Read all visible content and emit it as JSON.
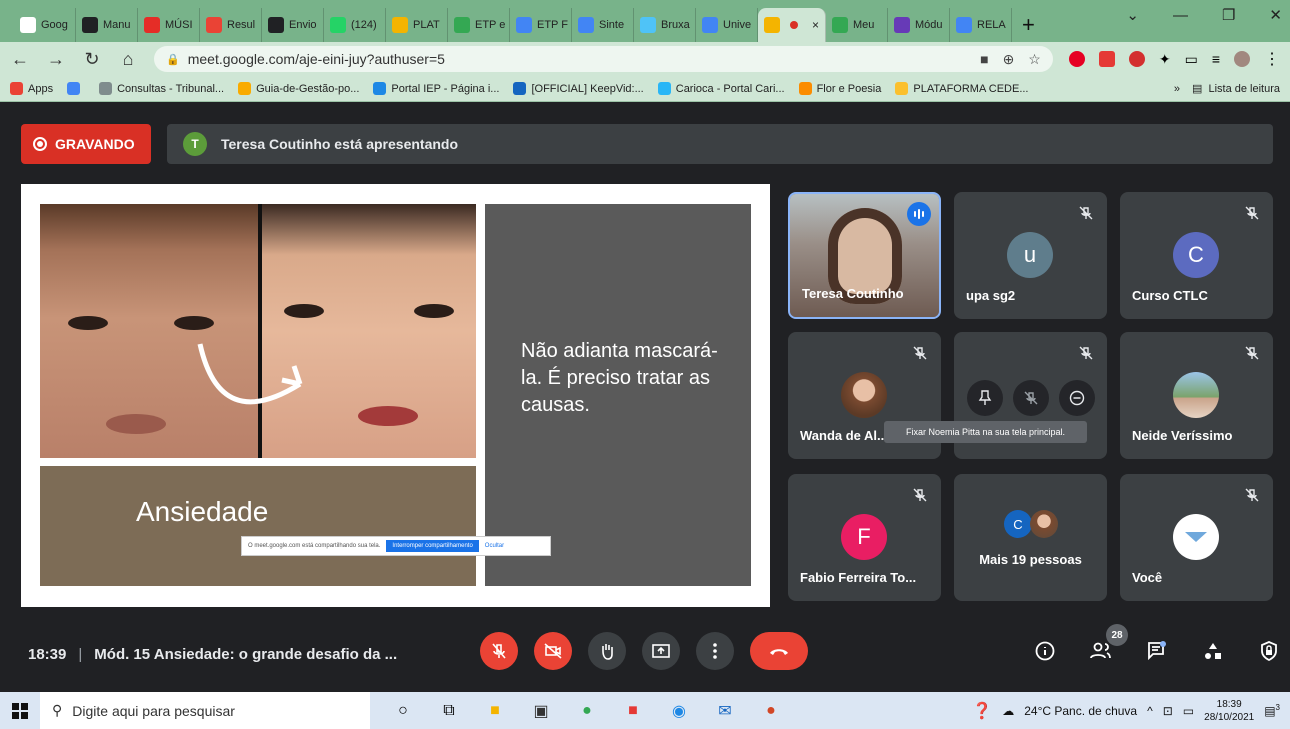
{
  "browser": {
    "tabs": [
      {
        "label": "Goog",
        "color": "#ffffff"
      },
      {
        "label": "Manu",
        "color": "#202124"
      },
      {
        "label": "MÚSI",
        "color": "#e52d27"
      },
      {
        "label": "Resul",
        "color": "#ea4335"
      },
      {
        "label": "Envio",
        "color": "#202124"
      },
      {
        "label": "(124)",
        "color": "#25d366"
      },
      {
        "label": "PLAT",
        "color": "#f4b400"
      },
      {
        "label": "ETP e",
        "color": "#34a853"
      },
      {
        "label": "ETP F",
        "color": "#4285f4"
      },
      {
        "label": "Sinte",
        "color": "#4285f4"
      },
      {
        "label": "Bruxa",
        "color": "#4fc3f7"
      },
      {
        "label": "Unive",
        "color": "#4285f4"
      },
      {
        "label": "",
        "color": "#f4b400",
        "active": true
      },
      {
        "label": "Meu",
        "color": "#34a853"
      },
      {
        "label": "Módu",
        "color": "#673ab7"
      },
      {
        "label": "RELA",
        "color": "#4285f4"
      }
    ],
    "new_tab": "+",
    "url": "meet.google.com/aje-eini-juy?authuser=5",
    "bookmarks": [
      {
        "label": "Apps",
        "color": "#ea4335"
      },
      {
        "label": "",
        "color": "#4285f4"
      },
      {
        "label": "Consultas - Tribunal...",
        "color": "#7f8c8d"
      },
      {
        "label": "Guia-de-Gestão-po...",
        "color": "#f9ab00"
      },
      {
        "label": "Portal IEP - Página i...",
        "color": "#1e88e5"
      },
      {
        "label": "[OFFICIAL] KeepVid:...",
        "color": "#1565c0"
      },
      {
        "label": "Carioca - Portal Cari...",
        "color": "#29b6f6"
      },
      {
        "label": "Flor e Poesia",
        "color": "#fb8c00"
      },
      {
        "label": "PLATAFORMA CEDE...",
        "color": "#fbc02d"
      }
    ],
    "more_bookmarks": "»",
    "reading_list": "Lista de leitura"
  },
  "meet": {
    "recording_label": "GRAVANDO",
    "presenter_initial": "T",
    "presenter_text": "Teresa Coutinho está apresentando",
    "slide": {
      "title": "Ansiedade",
      "body": "Não adianta mascará-la. É preciso tratar as causas.",
      "share_notice": "O meet.google.com está compartilhando sua tela.",
      "stop_sharing": "Interromper compartilhamento",
      "hide": "Ocultar"
    },
    "participants": [
      {
        "name": "Teresa Coutinho",
        "type": "video"
      },
      {
        "name": "upa sg2",
        "initial": "u",
        "color": "#5f7d8c"
      },
      {
        "name": "Curso CTLC",
        "initial": "C",
        "color": "#5c6bc0"
      },
      {
        "name": "Wanda de Al...",
        "type": "photo"
      },
      {
        "name": "Noemia Pitta",
        "type": "hover"
      },
      {
        "name": "Neide Veríssimo",
        "type": "photo"
      },
      {
        "name": "Fabio Ferreira To...",
        "initial": "F",
        "color": "#e91e63"
      },
      {
        "name": "Mais 19 pessoas",
        "initial": "C",
        "color": "#1565c0"
      },
      {
        "name": "Você",
        "type": "logo"
      }
    ],
    "tooltip": "Fixar Noemia Pitta na sua tela principal.",
    "time": "18:39",
    "meeting_title": "Mód. 15 Ansiedade: o grande desafio da ...",
    "participant_count": "28"
  },
  "taskbar": {
    "search_placeholder": "Digite aqui para pesquisar",
    "weather": "24°C  Panc. de chuva",
    "time": "18:39",
    "date": "28/10/2021",
    "notifications": "3"
  }
}
